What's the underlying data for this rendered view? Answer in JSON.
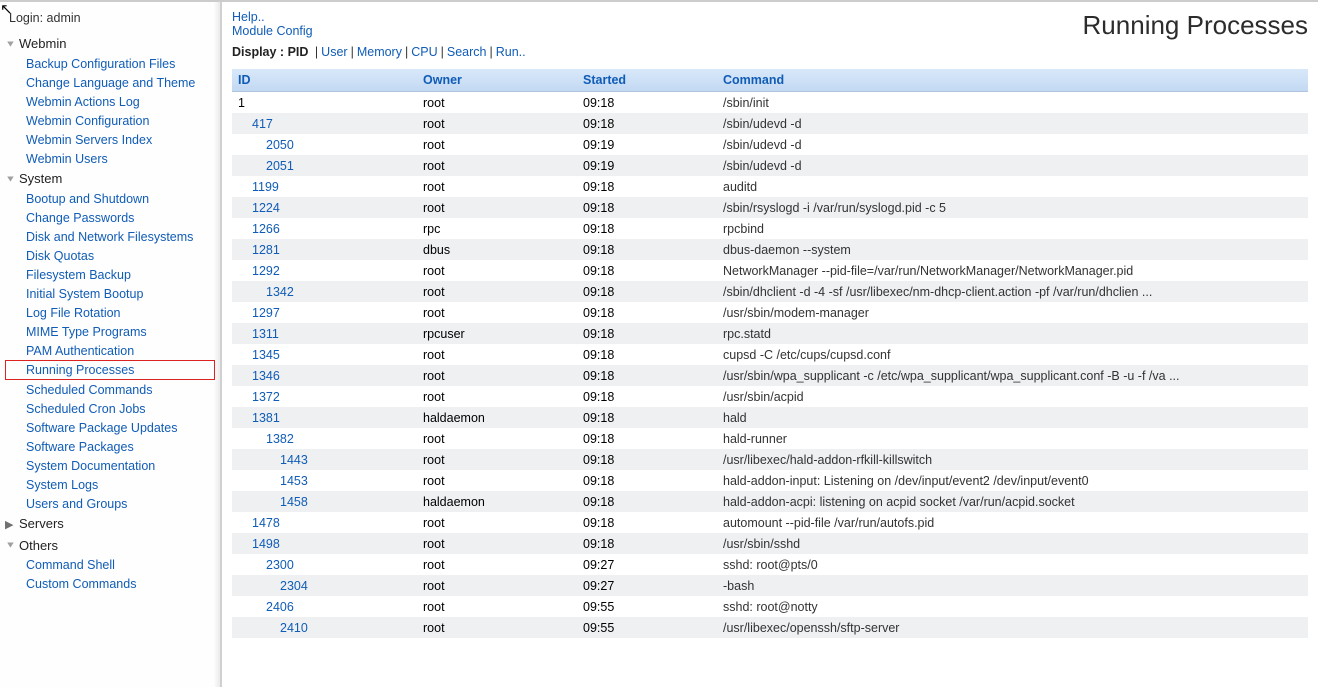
{
  "login": {
    "label": "Login:",
    "user": "admin"
  },
  "pageTitle": "Running Processes",
  "topLinks": {
    "help": "Help..",
    "moduleConfig": "Module Config"
  },
  "displayRow": {
    "label": "Display :",
    "current": "PID",
    "options": [
      "User",
      "Memory",
      "CPU",
      "Search",
      "Run.."
    ]
  },
  "sidebar": {
    "categories": [
      {
        "name": "Webmin",
        "expanded": true,
        "items": [
          "Backup Configuration Files",
          "Change Language and Theme",
          "Webmin Actions Log",
          "Webmin Configuration",
          "Webmin Servers Index",
          "Webmin Users"
        ]
      },
      {
        "name": "System",
        "expanded": true,
        "items": [
          "Bootup and Shutdown",
          "Change Passwords",
          "Disk and Network Filesystems",
          "Disk Quotas",
          "Filesystem Backup",
          "Initial System Bootup",
          "Log File Rotation",
          "MIME Type Programs",
          "PAM Authentication",
          "Running Processes",
          "Scheduled Commands",
          "Scheduled Cron Jobs",
          "Software Package Updates",
          "Software Packages",
          "System Documentation",
          "System Logs",
          "Users and Groups"
        ],
        "activeItem": "Running Processes"
      },
      {
        "name": "Servers",
        "expanded": false,
        "items": []
      },
      {
        "name": "Others",
        "expanded": true,
        "items": [
          "Command Shell",
          "Custom Commands"
        ]
      }
    ]
  },
  "table": {
    "headers": {
      "id": "ID",
      "owner": "Owner",
      "started": "Started",
      "command": "Command"
    },
    "rows": [
      {
        "pid": "1",
        "indent": 0,
        "link": false,
        "owner": "root",
        "started": "09:18",
        "command": "/sbin/init"
      },
      {
        "pid": "417",
        "indent": 1,
        "link": true,
        "owner": "root",
        "started": "09:18",
        "command": "/sbin/udevd -d"
      },
      {
        "pid": "2050",
        "indent": 2,
        "link": true,
        "owner": "root",
        "started": "09:19",
        "command": "/sbin/udevd -d"
      },
      {
        "pid": "2051",
        "indent": 2,
        "link": true,
        "owner": "root",
        "started": "09:19",
        "command": "/sbin/udevd -d"
      },
      {
        "pid": "1199",
        "indent": 1,
        "link": true,
        "owner": "root",
        "started": "09:18",
        "command": "auditd"
      },
      {
        "pid": "1224",
        "indent": 1,
        "link": true,
        "owner": "root",
        "started": "09:18",
        "command": "/sbin/rsyslogd -i /var/run/syslogd.pid -c 5"
      },
      {
        "pid": "1266",
        "indent": 1,
        "link": true,
        "owner": "rpc",
        "started": "09:18",
        "command": "rpcbind"
      },
      {
        "pid": "1281",
        "indent": 1,
        "link": true,
        "owner": "dbus",
        "started": "09:18",
        "command": "dbus-daemon --system"
      },
      {
        "pid": "1292",
        "indent": 1,
        "link": true,
        "owner": "root",
        "started": "09:18",
        "command": "NetworkManager --pid-file=/var/run/NetworkManager/NetworkManager.pid"
      },
      {
        "pid": "1342",
        "indent": 2,
        "link": true,
        "owner": "root",
        "started": "09:18",
        "command": "/sbin/dhclient -d -4 -sf /usr/libexec/nm-dhcp-client.action -pf /var/run/dhclien ..."
      },
      {
        "pid": "1297",
        "indent": 1,
        "link": true,
        "owner": "root",
        "started": "09:18",
        "command": "/usr/sbin/modem-manager"
      },
      {
        "pid": "1311",
        "indent": 1,
        "link": true,
        "owner": "rpcuser",
        "started": "09:18",
        "command": "rpc.statd"
      },
      {
        "pid": "1345",
        "indent": 1,
        "link": true,
        "owner": "root",
        "started": "09:18",
        "command": "cupsd -C /etc/cups/cupsd.conf"
      },
      {
        "pid": "1346",
        "indent": 1,
        "link": true,
        "owner": "root",
        "started": "09:18",
        "command": "/usr/sbin/wpa_supplicant -c /etc/wpa_supplicant/wpa_supplicant.conf -B -u -f /va ..."
      },
      {
        "pid": "1372",
        "indent": 1,
        "link": true,
        "owner": "root",
        "started": "09:18",
        "command": "/usr/sbin/acpid"
      },
      {
        "pid": "1381",
        "indent": 1,
        "link": true,
        "owner": "haldaemon",
        "started": "09:18",
        "command": "hald"
      },
      {
        "pid": "1382",
        "indent": 2,
        "link": true,
        "owner": "root",
        "started": "09:18",
        "command": "hald-runner"
      },
      {
        "pid": "1443",
        "indent": 3,
        "link": true,
        "owner": "root",
        "started": "09:18",
        "command": "/usr/libexec/hald-addon-rfkill-killswitch"
      },
      {
        "pid": "1453",
        "indent": 3,
        "link": true,
        "owner": "root",
        "started": "09:18",
        "command": "hald-addon-input: Listening on /dev/input/event2 /dev/input/event0"
      },
      {
        "pid": "1458",
        "indent": 3,
        "link": true,
        "owner": "haldaemon",
        "started": "09:18",
        "command": "hald-addon-acpi: listening on acpid socket /var/run/acpid.socket"
      },
      {
        "pid": "1478",
        "indent": 1,
        "link": true,
        "owner": "root",
        "started": "09:18",
        "command": "automount --pid-file /var/run/autofs.pid"
      },
      {
        "pid": "1498",
        "indent": 1,
        "link": true,
        "owner": "root",
        "started": "09:18",
        "command": "/usr/sbin/sshd"
      },
      {
        "pid": "2300",
        "indent": 2,
        "link": true,
        "owner": "root",
        "started": "09:27",
        "command": "sshd: root@pts/0"
      },
      {
        "pid": "2304",
        "indent": 3,
        "link": true,
        "owner": "root",
        "started": "09:27",
        "command": "-bash"
      },
      {
        "pid": "2406",
        "indent": 2,
        "link": true,
        "owner": "root",
        "started": "09:55",
        "command": "sshd: root@notty"
      },
      {
        "pid": "2410",
        "indent": 3,
        "link": true,
        "owner": "root",
        "started": "09:55",
        "command": "/usr/libexec/openssh/sftp-server"
      }
    ]
  }
}
